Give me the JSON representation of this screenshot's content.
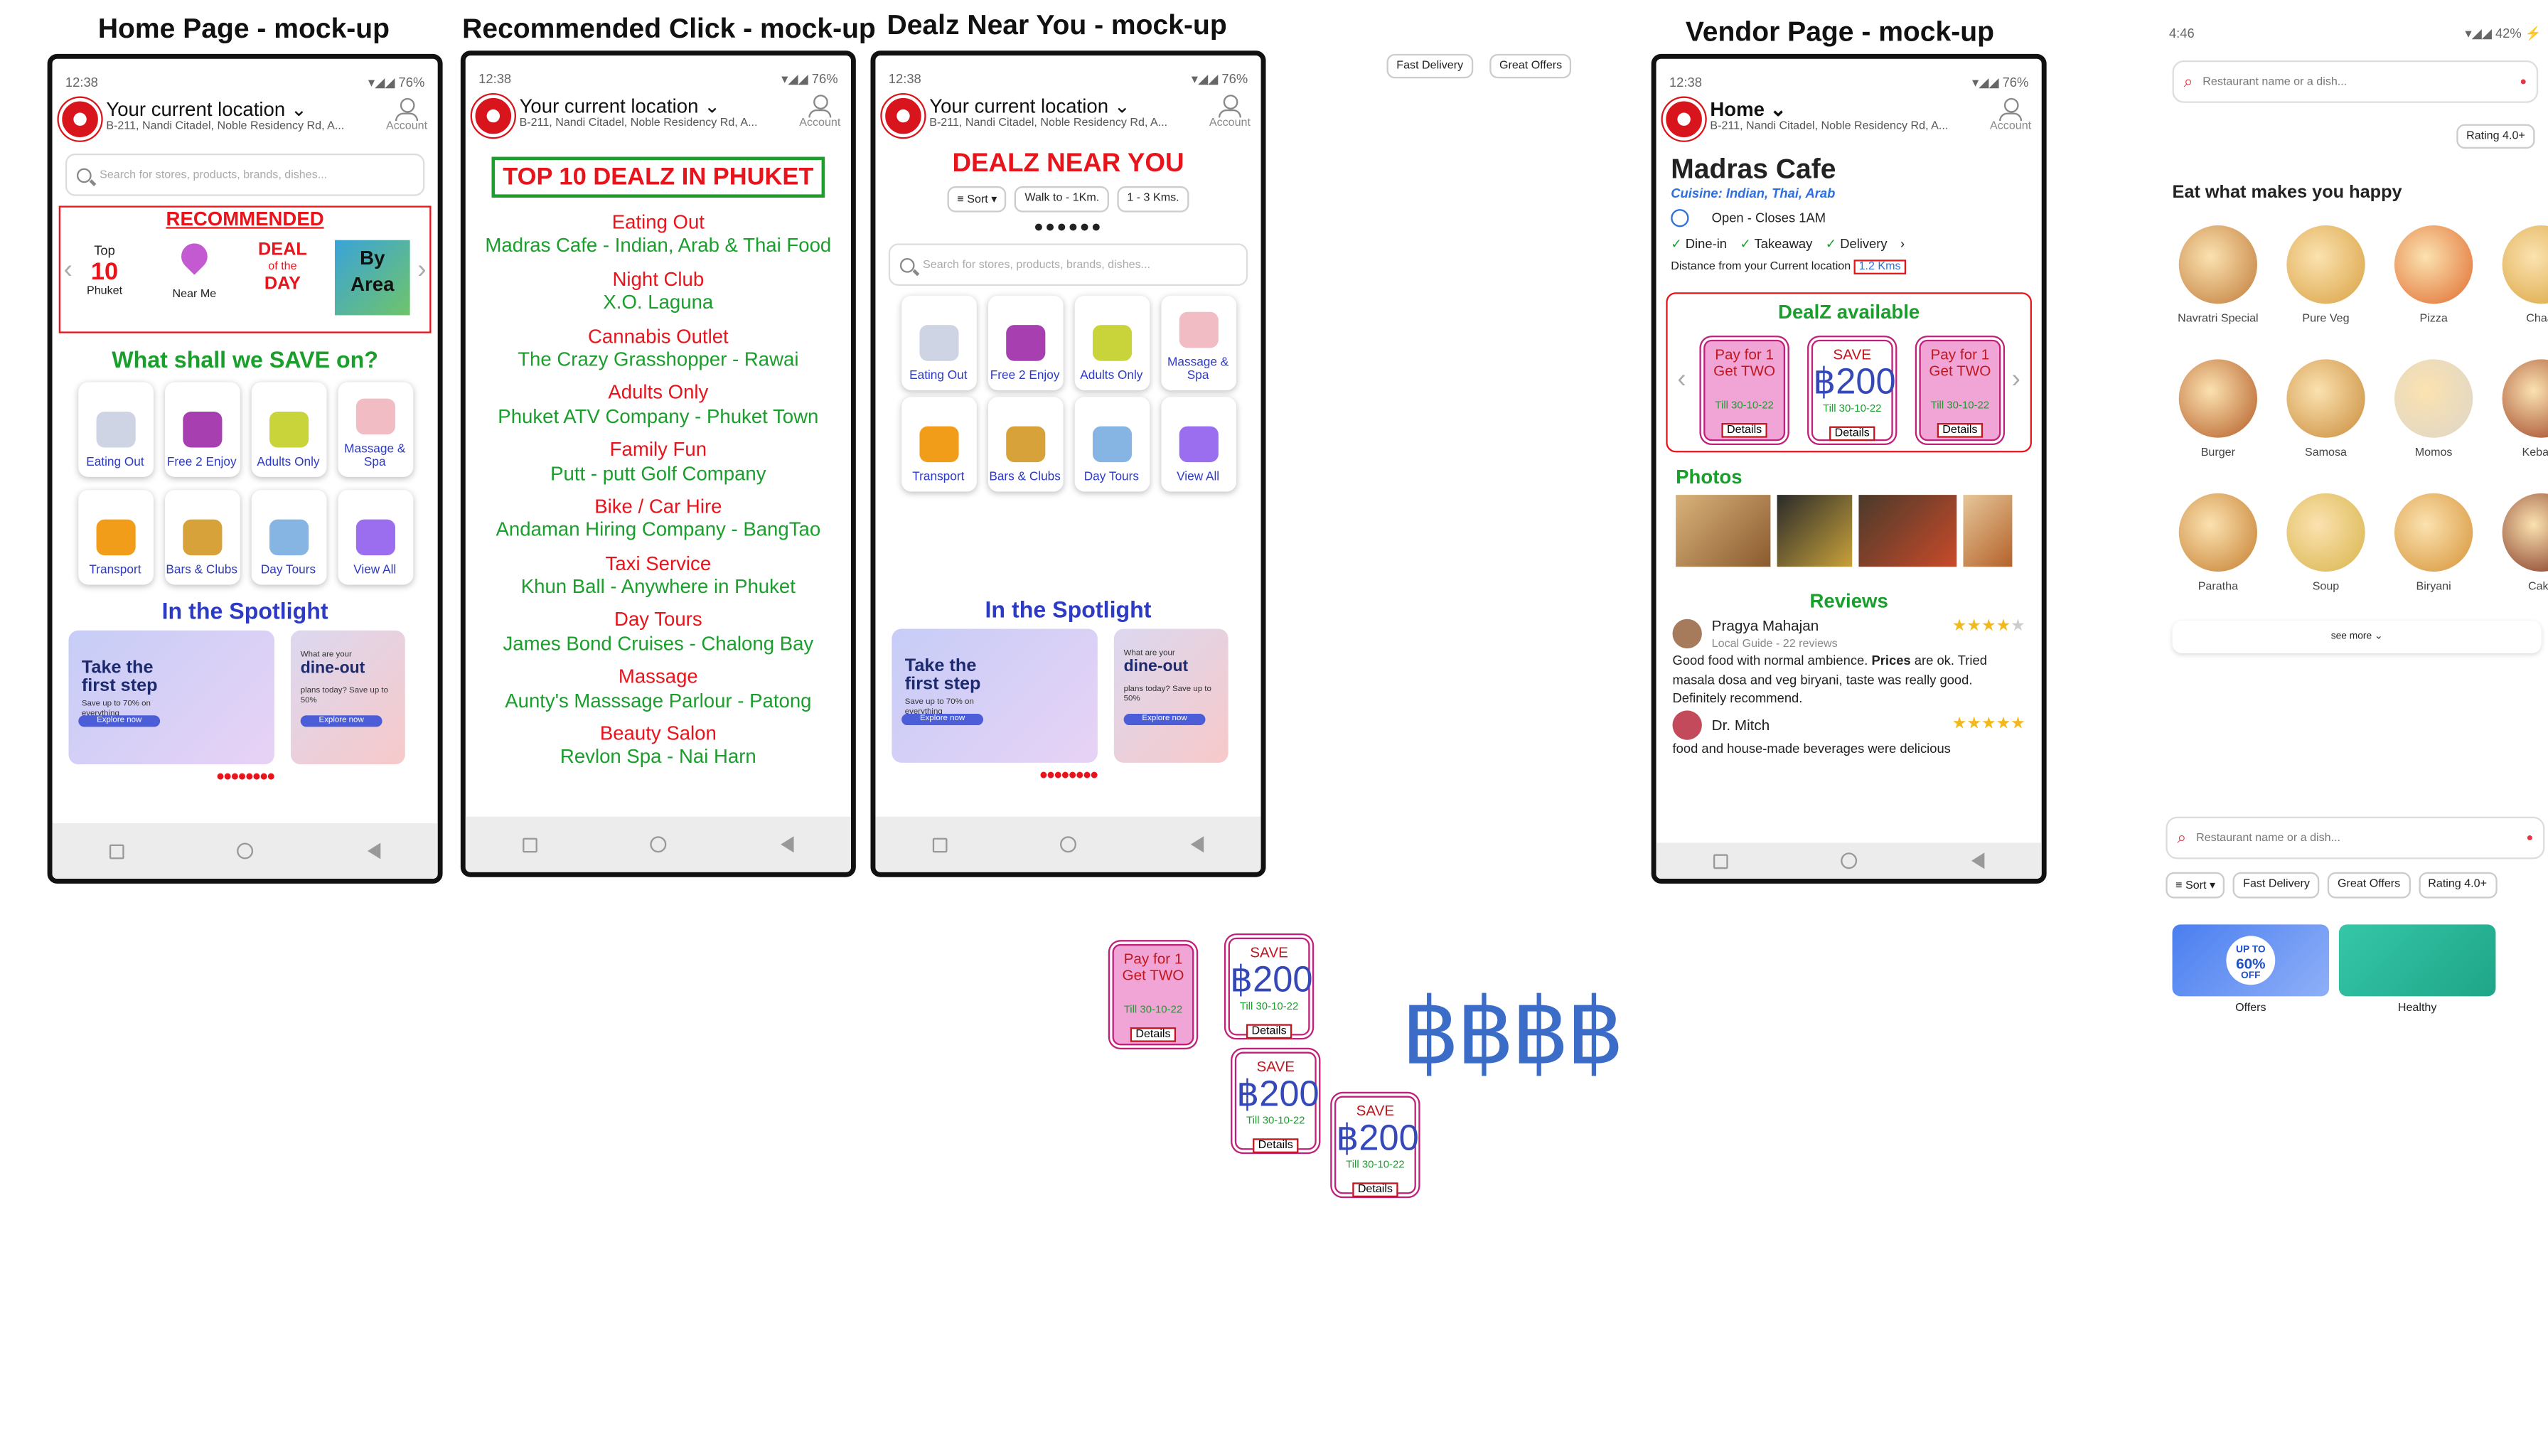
{
  "titles": {
    "home": "Home Page  - mock-up",
    "recommended": "Recommended Click - mock-up",
    "near": "Dealz Near You - mock-up",
    "vendor": "Vendor Page - mock-up"
  },
  "status": {
    "time": "12:38",
    "battery": "76%"
  },
  "header": {
    "location_title": "Your current location",
    "address": "B-211, Nandi Citadel, Noble Residency Rd, A...",
    "account": "Account",
    "search_placeholder": "Search for stores, products, brands, dishes...",
    "vendor_title": "Home"
  },
  "home": {
    "recommended": "RECOMMENDED",
    "top_label": "Top",
    "top_num": "10",
    "top_place": "Phuket",
    "near_me": "Near Me",
    "deal_of_day_1": "DEAL",
    "deal_of_day_2": "of the",
    "deal_of_day_3": "DAY",
    "by_area_1": "By",
    "by_area_2": "Area",
    "save_title": "What shall we SAVE on?",
    "spotlight": "In the Spotlight"
  },
  "categories": [
    {
      "label": "Eating Out",
      "color": "#cfd4e4"
    },
    {
      "label": "Free 2 Enjoy",
      "color": "#a73fb0"
    },
    {
      "label": "Adults Only",
      "color": "#c9d43a"
    },
    {
      "label": "Massage & Spa",
      "color": "#f1bcc4"
    },
    {
      "label": "Transport",
      "color": "#f29d1a"
    },
    {
      "label": "Bars & Clubs",
      "color": "#d8a23a"
    },
    {
      "label": "Day Tours",
      "color": "#86b5e3"
    },
    {
      "label": "View All",
      "color": "#9b6ef0"
    }
  ],
  "banners": {
    "b1_line1": "Take the",
    "b1_line2": "first step",
    "b1_sub": "Save up to 70% on everything",
    "b1_btn": "Explore now",
    "b2_line1": "What are your",
    "b2_line2": "dine-out",
    "b2_sub": "plans today? Save up to 50%",
    "b2_btn": "Explore now"
  },
  "recommended_page": {
    "title": "TOP 10 DEALZ IN PHUKET",
    "items": [
      {
        "cat": "Eating Out",
        "vendor": "Madras Cafe - Indian, Arab & Thai Food"
      },
      {
        "cat": "Night Club",
        "vendor": "X.O. Laguna"
      },
      {
        "cat": "Cannabis Outlet",
        "vendor": "The Crazy Grasshopper - Rawai"
      },
      {
        "cat": "Adults Only",
        "vendor": "Phuket ATV Company - Phuket Town"
      },
      {
        "cat": "Family Fun",
        "vendor": "Putt - putt Golf Company"
      },
      {
        "cat": "Bike / Car Hire",
        "vendor": "Andaman Hiring Company - BangTao"
      },
      {
        "cat": "Taxi Service",
        "vendor": "Khun Ball - Anywhere in Phuket"
      },
      {
        "cat": "Day Tours",
        "vendor": "James Bond Cruises - Chalong Bay"
      },
      {
        "cat": "Massage",
        "vendor": "Aunty's Masssage Parlour - Patong"
      },
      {
        "cat": "Beauty Salon",
        "vendor": "Revlon Spa - Nai Harn"
      }
    ]
  },
  "near_page": {
    "title": "DEALZ NEAR YOU",
    "sort": "Sort",
    "walk": "Walk to - 1Km.",
    "km": "1 - 3 Kms."
  },
  "chips_float": {
    "fast": "Fast Delivery",
    "great": "Great Offers"
  },
  "vendor": {
    "name": "Madras Cafe",
    "cuisine": "Cuisine: Indian, Thai, Arab",
    "hours": "Open - Closes 1AM",
    "dinein": "Dine-in",
    "takeaway": "Takeaway",
    "delivery": "Delivery",
    "distance_label": "Distance from your Current location",
    "distance": "1.2 Kms",
    "dealz_title": "DealZ available",
    "photos": "Photos",
    "reviews": "Reviews",
    "r1_name": "Pragya Mahajan",
    "r1_meta": "Local Guide - 22 reviews",
    "r1_stars": "★★★★",
    "r1_star_off": "★",
    "r1_text_a": "Good food with normal ambience. ",
    "r1_text_b": "Prices",
    "r1_text_c": " are ok. Tried masala dosa and veg biryani, taste was really good. Definitely recommend.",
    "r2_name": "Dr. Mitch",
    "r2_stars": "★★★★★",
    "r2_text": "food and house-made beverages were delicious"
  },
  "deals": {
    "pay1": "Pay for 1",
    "pay2": "Get TWO",
    "save": "SAVE",
    "amount": "฿200",
    "till": "Till 30-10-22",
    "details": "Details"
  },
  "baht_symbols": "฿฿฿฿",
  "zomato": {
    "time": "4:46",
    "battery": "42%",
    "search": "Restaurant name or a dish...",
    "rating": "Rating 4.0+",
    "heading": "Eat what makes you happy",
    "foods": [
      {
        "name": "Navratri Special",
        "color": "#c07a38"
      },
      {
        "name": "Pure Veg",
        "color": "#d9a141"
      },
      {
        "name": "Pizza",
        "color": "#e06b2d"
      },
      {
        "name": "Chaat",
        "color": "#d9a33d"
      },
      {
        "name": "Burger",
        "color": "#b45a24"
      },
      {
        "name": "Samosa",
        "color": "#c98b3a"
      },
      {
        "name": "Momos",
        "color": "#ddd6c8"
      },
      {
        "name": "Kebabs",
        "color": "#9a3a1e"
      },
      {
        "name": "Paratha",
        "color": "#c57d2e"
      },
      {
        "name": "Soup",
        "color": "#d8b44a"
      },
      {
        "name": "Biryani",
        "color": "#d69235"
      },
      {
        "name": "Cake",
        "color": "#7a2a1a"
      }
    ],
    "see_more": "see more",
    "search2": "Restaurant name or a dish...",
    "sort": "Sort",
    "fast": "Fast Delivery",
    "great": "Great Offers",
    "rating2": "Rating 4.0+",
    "offers": "Offers",
    "healthy": "Healthy",
    "offer_badge_1": "UP TO",
    "offer_badge_2": "60%",
    "offer_badge_3": "OFF"
  }
}
